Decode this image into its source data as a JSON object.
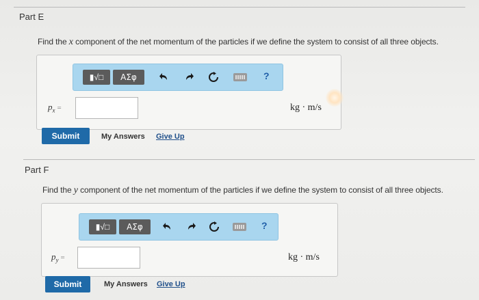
{
  "partE": {
    "title": "Part E",
    "question_before": "Find the ",
    "question_var": "x",
    "question_after": " component of the net momentum of the particles if we define the system to consist of all three objects.",
    "toolbar": {
      "templates_label": "▮√□",
      "symbols_label": "ΑΣφ",
      "help_label": "?"
    },
    "variable": "p",
    "variable_sub": "x",
    "equals": "=",
    "input_value": "",
    "unit": "kg · m/s",
    "submit_label": "Submit",
    "my_answers_label": "My Answers",
    "give_up_label": "Give Up"
  },
  "partF": {
    "title": "Part F",
    "question_before": "Find the ",
    "question_var": "y",
    "question_after": " component of the net momentum of the particles if we define the system to consist of all three objects.",
    "toolbar": {
      "templates_label": "▮√□",
      "symbols_label": "ΑΣφ",
      "help_label": "?"
    },
    "variable": "p",
    "variable_sub": "y",
    "equals": "=",
    "input_value": "",
    "unit": "kg · m/s",
    "submit_label": "Submit",
    "my_answers_label": "My Answers",
    "give_up_label": "Give Up"
  },
  "icons": [
    "undo-icon",
    "redo-icon",
    "reset-icon",
    "keyboard-icon",
    "help-icon"
  ],
  "colors": {
    "toolbar_bg": "#a9d6ef",
    "submit_bg": "#1f6aa8",
    "link": "#1f4f8a"
  }
}
